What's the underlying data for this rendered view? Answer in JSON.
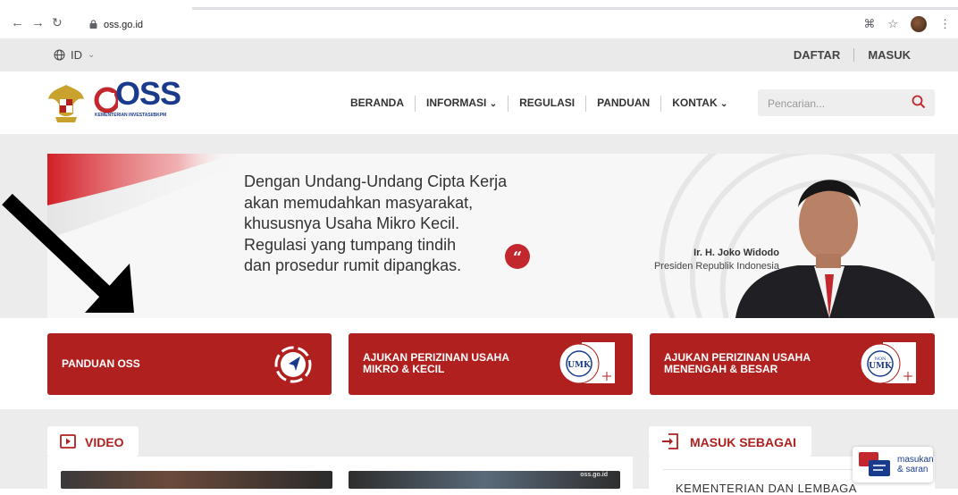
{
  "browser": {
    "url": "oss.go.id",
    "icons": [
      "back-icon",
      "forward-icon",
      "reload-icon",
      "lock-icon",
      "translate-icon",
      "star-icon",
      "profile-avatar",
      "menu-icon"
    ]
  },
  "topbar": {
    "language": "ID",
    "daftar": "DAFTAR",
    "masuk": "MASUK"
  },
  "header": {
    "logo_text": "OSS",
    "logo_subtitle": "KEMENTERIAN INVESTASI/BKPM",
    "nav": [
      "BERANDA",
      "INFORMASI",
      "REGULASI",
      "PANDUAN",
      "KONTAK"
    ],
    "search_placeholder": "Pencarian..."
  },
  "hero": {
    "quote_lines": [
      "Dengan Undang-Undang Cipta Kerja",
      "akan memudahkan masyarakat,",
      "khususnya Usaha Mikro Kecil.",
      "Regulasi yang tumpang tindih",
      "dan prosedur rumit dipangkas."
    ],
    "quote_mark": "“",
    "name": "Ir. H. Joko Widodo",
    "role": "Presiden Republik Indonesia"
  },
  "cards": [
    {
      "line1": "PANDUAN OSS",
      "line2": ""
    },
    {
      "line1": "AJUKAN PERIZINAN USAHA",
      "line2": "MIKRO & KECIL",
      "badge": "UMK",
      "badge_ring": "USAHA MIKRO & KECIL"
    },
    {
      "line1": "AJUKAN PERIZINAN USAHA",
      "line2": "MENENGAH & BESAR",
      "badge_top": "NON",
      "badge": "UMK",
      "badge_ring": "USAHA MENENGAH & BESAR"
    }
  ],
  "lower": {
    "video_label": "VIDEO",
    "masuk_label": "MASUK SEBAGAI",
    "masuk_item": "KEMENTERIAN DAN LEMBAGA",
    "thumb_watermark": "oss.go.id",
    "feedback_line1": "masukan",
    "feedback_line2": "& saran"
  },
  "colors": {
    "brand_red": "#b0201f",
    "brand_blue": "#1a3b8c"
  }
}
